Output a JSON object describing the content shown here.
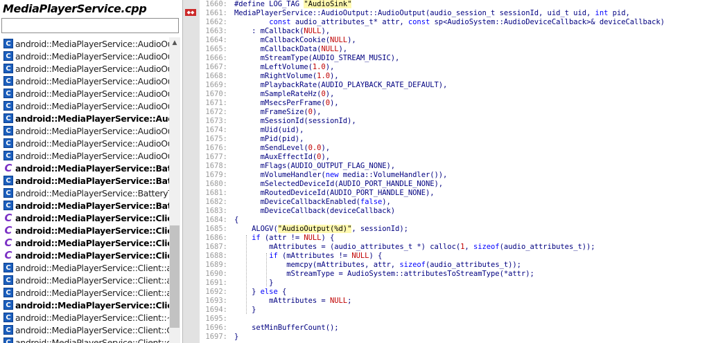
{
  "file_panel": {
    "title": "MediaPlayerService.cpp",
    "search": {
      "value": "",
      "placeholder": ""
    },
    "items": [
      {
        "label": "android::MediaPlayerService::AudioOutput::getPlaybackRate",
        "bold": false,
        "icon": "method-icon"
      },
      {
        "label": "android::MediaPlayerService::AudioOutput::getRoutedDeviceId",
        "bold": false,
        "icon": "method-icon"
      },
      {
        "label": "android::MediaPlayerService::AudioOutput::getSampleRate",
        "bold": false,
        "icon": "method-icon"
      },
      {
        "label": "android::MediaPlayerService::AudioOutput::getSessionId",
        "bold": false,
        "icon": "method-icon"
      },
      {
        "label": "android::MediaPlayerService::AudioOutput::getTimestamp",
        "bold": false,
        "icon": "method-icon"
      },
      {
        "label": "android::MediaPlayerService::AudioOutput::getVolumeHandler",
        "bold": false,
        "icon": "method-icon"
      },
      {
        "label": "android::MediaPlayerService::AudioOutput::latency",
        "bold": true,
        "icon": "method-icon"
      },
      {
        "label": "android::MediaPlayerService::AudioOutput::msecsPerFrame",
        "bold": false,
        "icon": "method-icon"
      },
      {
        "label": "android::MediaPlayerService::AudioOutput::open",
        "bold": false,
        "icon": "method-icon"
      },
      {
        "label": "android::MediaPlayerService::AudioOutput::pause",
        "bold": false,
        "icon": "method-icon"
      },
      {
        "label": "android::MediaPlayerService::BatteryTracker",
        "bold": true,
        "icon": "class-icon"
      },
      {
        "label": "android::MediaPlayerService::BatteryTracker::BatteryTracker",
        "bold": true,
        "icon": "method-icon"
      },
      {
        "label": "android::MediaPlayerService::BatteryTracker::reset",
        "bold": false,
        "icon": "method-icon"
      },
      {
        "label": "android::MediaPlayerService::BatteryTracker::setAudioStatus",
        "bold": true,
        "icon": "method-icon"
      },
      {
        "label": "android::MediaPlayerService::Client",
        "bold": true,
        "icon": "class-icon"
      },
      {
        "label": "android::MediaPlayerService::Client",
        "bold": true,
        "icon": "class-icon"
      },
      {
        "label": "android::MediaPlayerService::Client",
        "bold": true,
        "icon": "class-icon"
      },
      {
        "label": "android::MediaPlayerService::Client",
        "bold": true,
        "icon": "class-icon"
      },
      {
        "label": "android::MediaPlayerService::Client::addListener",
        "bold": false,
        "icon": "method-icon"
      },
      {
        "label": "android::MediaPlayerService::Client::applyVolumeShaper",
        "bold": false,
        "icon": "method-icon"
      },
      {
        "label": "android::MediaPlayerService::Client::attachAuxEffect",
        "bold": false,
        "icon": "method-icon"
      },
      {
        "label": "android::MediaPlayerService::Client::AudioDeviceUpdatedNotifier",
        "bold": true,
        "icon": "method-icon"
      },
      {
        "label": "android::MediaPlayerService::Client::~Client",
        "bold": false,
        "icon": "method-icon"
      },
      {
        "label": "android::MediaPlayerService::Client::Client",
        "bold": false,
        "icon": "method-icon"
      },
      {
        "label": "android::MediaPlayerService::Client::disconnect",
        "bold": false,
        "icon": "method-icon"
      }
    ]
  },
  "bookmark_icon": "fold-marker-icon",
  "editor": {
    "lines": [
      {
        "num": "1660:",
        "html": "<span class=\"pp\">#define LOG_TAG </span><span class=\"s hl\">\"AudioSink\"</span>"
      },
      {
        "num": "1661:",
        "html": "MediaPlayerService::AudioOutput::AudioOutput(audio_session_t sessionId, uid_t uid, <span class=\"k\">int</span> pid,"
      },
      {
        "num": "1662:",
        "html": "        <span class=\"k\">const</span> audio_attributes_t* attr, <span class=\"k\">const</span> sp&lt;AudioSystem::AudioDeviceCallback&gt;&amp; deviceCallback)"
      },
      {
        "num": "1663:",
        "html": "    : mCallback(<span class=\"n\">NULL</span>),"
      },
      {
        "num": "1664:",
        "html": "      mCallbackCookie(<span class=\"n\">NULL</span>),"
      },
      {
        "num": "1665:",
        "html": "      mCallbackData(<span class=\"n\">NULL</span>),"
      },
      {
        "num": "1666:",
        "html": "      mStreamType(AUDIO_STREAM_MUSIC),"
      },
      {
        "num": "1667:",
        "html": "      mLeftVolume(<span class=\"n\">1.0</span>),"
      },
      {
        "num": "1668:",
        "html": "      mRightVolume(<span class=\"n\">1.0</span>),"
      },
      {
        "num": "1669:",
        "html": "      mPlaybackRate(AUDIO_PLAYBACK_RATE_DEFAULT),"
      },
      {
        "num": "1670:",
        "html": "      mSampleRateHz(<span class=\"n\">0</span>),"
      },
      {
        "num": "1671:",
        "html": "      mMsecsPerFrame(<span class=\"n\">0</span>),"
      },
      {
        "num": "1672:",
        "html": "      mFrameSize(<span class=\"n\">0</span>),"
      },
      {
        "num": "1673:",
        "html": "      mSessionId(sessionId),"
      },
      {
        "num": "1674:",
        "html": "      mUid(uid),"
      },
      {
        "num": "1675:",
        "html": "      mPid(pid),"
      },
      {
        "num": "1676:",
        "html": "      mSendLevel(<span class=\"n\">0.0</span>),"
      },
      {
        "num": "1677:",
        "html": "      mAuxEffectId(<span class=\"n\">0</span>),"
      },
      {
        "num": "1678:",
        "html": "      mFlags(AUDIO_OUTPUT_FLAG_NONE),"
      },
      {
        "num": "1679:",
        "html": "      mVolumeHandler(<span class=\"k\">new</span> media::VolumeHandler()),"
      },
      {
        "num": "1680:",
        "html": "      mSelectedDeviceId(AUDIO_PORT_HANDLE_NONE),"
      },
      {
        "num": "1681:",
        "html": "      mRoutedDeviceId(AUDIO_PORT_HANDLE_NONE),"
      },
      {
        "num": "1682:",
        "html": "      mDeviceCallbackEnabled(<span class=\"k\">false</span>),"
      },
      {
        "num": "1683:",
        "html": "      mDeviceCallback(deviceCallback)"
      },
      {
        "num": "1684:",
        "html": "{"
      },
      {
        "num": "1685:",
        "html": "    ALOGV(<span class=\"s hl\">\"AudioOutput(%d)\"</span>, sessionId);"
      },
      {
        "num": "1686:",
        "html": "    <span class=\"k\">if</span> (attr != <span class=\"n\">NULL</span>) {"
      },
      {
        "num": "1687:",
        "html": "        mAttributes = (audio_attributes_t *) calloc(<span class=\"n\">1</span>, <span class=\"k\">sizeof</span>(audio_attributes_t));"
      },
      {
        "num": "1688:",
        "html": "        <span class=\"k\">if</span> (mAttributes != <span class=\"n\">NULL</span>) {"
      },
      {
        "num": "1689:",
        "html": "            memcpy(mAttributes, attr, <span class=\"k\">sizeof</span>(audio_attributes_t));"
      },
      {
        "num": "1690:",
        "html": "            mStreamType = AudioSystem::attributesToStreamType(*attr);"
      },
      {
        "num": "1691:",
        "html": "        }"
      },
      {
        "num": "1692:",
        "html": "    } <span class=\"k\">else</span> {"
      },
      {
        "num": "1693:",
        "html": "        mAttributes = <span class=\"n\">NULL</span>;"
      },
      {
        "num": "1694:",
        "html": "    }"
      },
      {
        "num": "1695:",
        "html": ""
      },
      {
        "num": "1696:",
        "html": "    setMinBufferCount();"
      },
      {
        "num": "1697:",
        "html": "}"
      }
    ]
  }
}
